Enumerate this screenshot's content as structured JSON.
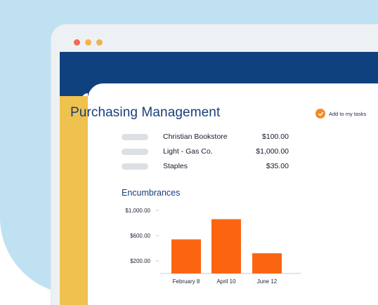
{
  "header": {
    "logo_icon": "pie-chart-icon"
  },
  "window_controls": {
    "colors": [
      "#f26a55",
      "#f6b63e",
      "#f0b24b"
    ]
  },
  "page": {
    "title": "Purchasing Management",
    "add_task_label": "Add to my tasks",
    "add_task_icon": "checkmark-icon",
    "accent_color": "#f7891f"
  },
  "purchases": [
    {
      "vendor": "Christian Bookstore",
      "amount": "$100.00"
    },
    {
      "vendor": "Light - Gas Co.",
      "amount": "$1,000.00"
    },
    {
      "vendor": "Staples",
      "amount": "$35.00"
    }
  ],
  "encumbrances": {
    "title": "Encumbrances"
  },
  "chart_data": {
    "type": "bar",
    "title": "Encumbrances",
    "categories": [
      "February 8",
      "April 10",
      "June 12"
    ],
    "values": [
      540,
      860,
      320
    ],
    "ylim": [
      0,
      1000
    ],
    "y_ticks": [
      {
        "value": 1000,
        "label": "$1,000.00"
      },
      {
        "value": 600,
        "label": "$600.00"
      },
      {
        "value": 200,
        "label": "$200.00"
      }
    ],
    "bar_color": "#fb6512",
    "grid": false,
    "xlabel": "",
    "ylabel": ""
  }
}
